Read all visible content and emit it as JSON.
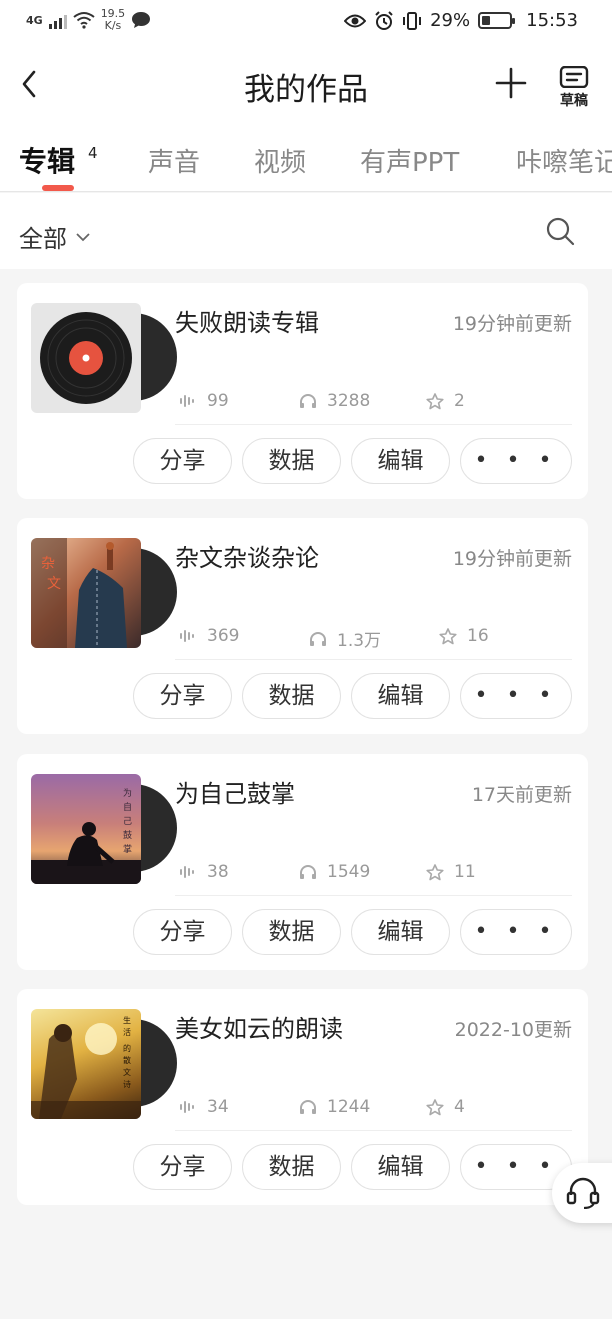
{
  "status_bar": {
    "network": "4G",
    "speed_value": "19.5",
    "speed_unit": "K/s",
    "battery": "29%",
    "battery_level": 0.29,
    "time": "15:53"
  },
  "nav": {
    "title": "我的作品",
    "draft_label": "草稿"
  },
  "tabs": [
    {
      "label": "专辑",
      "count": "4",
      "active": true
    },
    {
      "label": "声音"
    },
    {
      "label": "视频"
    },
    {
      "label": "有声PPT"
    },
    {
      "label": "咔嚓笔记"
    }
  ],
  "filter": {
    "label": "全部"
  },
  "albums": [
    {
      "title": "失败朗读专辑",
      "updated": "19分钟前更新",
      "tracks": "99",
      "plays": "3288",
      "subs": "2",
      "cover": "vinyl"
    },
    {
      "title": "杂文杂谈杂论",
      "updated": "19分钟前更新",
      "tracks": "369",
      "plays": "1.3万",
      "subs": "16",
      "cover": "mannequin"
    },
    {
      "title": "为自己鼓掌",
      "updated": "17天前更新",
      "tracks": "38",
      "plays": "1549",
      "subs": "11",
      "cover": "sunset-silhouette"
    },
    {
      "title": "美女如云的朗读",
      "updated": "2022-10更新",
      "tracks": "34",
      "plays": "1244",
      "subs": "4",
      "cover": "golden-field"
    }
  ],
  "actions": {
    "share": "分享",
    "data": "数据",
    "edit": "编辑",
    "more": "• • •"
  },
  "colors": {
    "accent": "#f2594b",
    "muted": "#999999"
  }
}
